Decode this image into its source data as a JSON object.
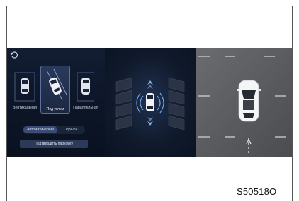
{
  "parking": {
    "modes": [
      {
        "label": "Вертикальная"
      },
      {
        "label": "Под углом"
      },
      {
        "label": "Параллельная"
      }
    ],
    "selected_mode": "Под углом",
    "toggle": {
      "auto_label": "Автоматический",
      "manual_label": "Ручной",
      "selected": "Автоматический"
    },
    "confirm_label": "Подтвердить парковку"
  },
  "caption": "S50518O",
  "colors": {
    "screen_bg": "#0e1626",
    "selected_card": "#2a3a5c",
    "camera_ground": "#5a5c60",
    "sensor_wave": "#7fb7ff"
  }
}
